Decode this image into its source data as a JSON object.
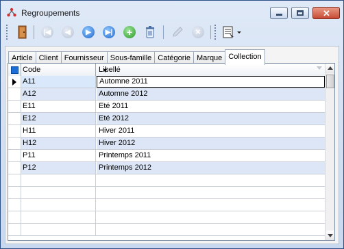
{
  "window": {
    "title": "Regroupements"
  },
  "tabs": [
    {
      "label": "Article"
    },
    {
      "label": "Client"
    },
    {
      "label": "Fournisseur"
    },
    {
      "label": "Sous-famille"
    },
    {
      "label": "Catégorie"
    },
    {
      "label": "Marque"
    },
    {
      "label": "Collection"
    }
  ],
  "active_tab": "Collection",
  "toolbar": {
    "icons": [
      "exit-door-icon",
      "first-record-icon",
      "previous-record-icon",
      "next-record-icon",
      "last-record-icon",
      "add-icon",
      "delete-icon",
      "edit-icon",
      "cancel-icon",
      "print-icon"
    ]
  },
  "grid": {
    "columns": [
      {
        "label": "Code"
      },
      {
        "label": "Libellé"
      }
    ],
    "rows": [
      {
        "code": "A11",
        "label": "Automne 2011"
      },
      {
        "code": "A12",
        "label": "Automne 2012"
      },
      {
        "code": "E11",
        "label": "Eté 2011"
      },
      {
        "code": "E12",
        "label": "Eté 2012"
      },
      {
        "code": "H11",
        "label": "Hiver 2011"
      },
      {
        "code": "H12",
        "label": "Hiver 2012"
      },
      {
        "code": "P11",
        "label": "Printemps 2011"
      },
      {
        "code": "P12",
        "label": "Printemps 2012"
      }
    ]
  },
  "colors": {
    "row_alt": "#dce6f7",
    "accent": "#1d6ed8",
    "title_bg": "#c8d8ef"
  }
}
